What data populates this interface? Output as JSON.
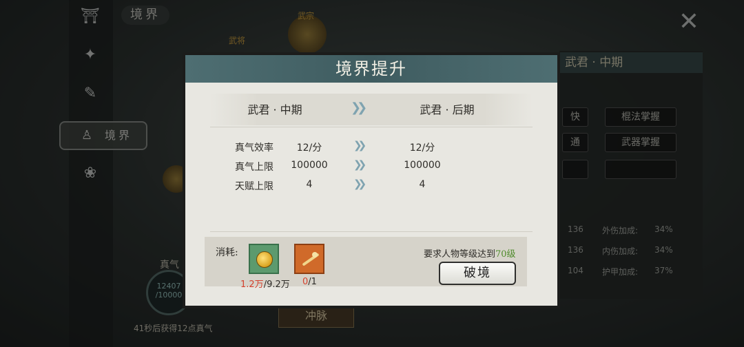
{
  "background": {
    "top_label": "境界",
    "nav_active_label": "境界",
    "right_panel": {
      "header": "武君 · 中期",
      "buttons": [
        "快",
        "棍法掌握",
        "通",
        "武器掌握"
      ],
      "stats": [
        {
          "value": "136",
          "label": "外伤加成:",
          "pct": "34%"
        },
        {
          "value": "136",
          "label": "内伤加成:",
          "pct": "34%"
        },
        {
          "value": "104",
          "label": "护甲加成:",
          "pct": "37%"
        }
      ]
    },
    "realm_marks": [
      "武宗",
      "武将"
    ],
    "qi_label": "真气",
    "qi_current": "12407",
    "qi_max": "/10000",
    "qi_hint": "41秒后获得12点真气",
    "chongmai_label": "冲脉"
  },
  "modal": {
    "title": "境界提升",
    "from_realm": "武君 · 中期",
    "to_realm": "武君 · 后期",
    "stats": [
      {
        "label": "真气效率",
        "from": "12/分",
        "to": "12/分"
      },
      {
        "label": "真气上限",
        "from": "100000",
        "to": "100000"
      },
      {
        "label": "天赋上限",
        "from": "4",
        "to": "4"
      }
    ],
    "cost_label": "消耗:",
    "items": [
      {
        "icon": "gold-coin-icon",
        "have": "1.2万",
        "need": "/9.2万"
      },
      {
        "icon": "golden-branch-icon",
        "have": "0",
        "need": "/1"
      }
    ],
    "requirement_prefix": "要求人物等级达到",
    "requirement_level": "70级",
    "break_button": "破境"
  },
  "colors": {
    "title_bar": "#4e6e72",
    "insufficient": "#d4422e",
    "requirement": "#4f8b2b"
  }
}
